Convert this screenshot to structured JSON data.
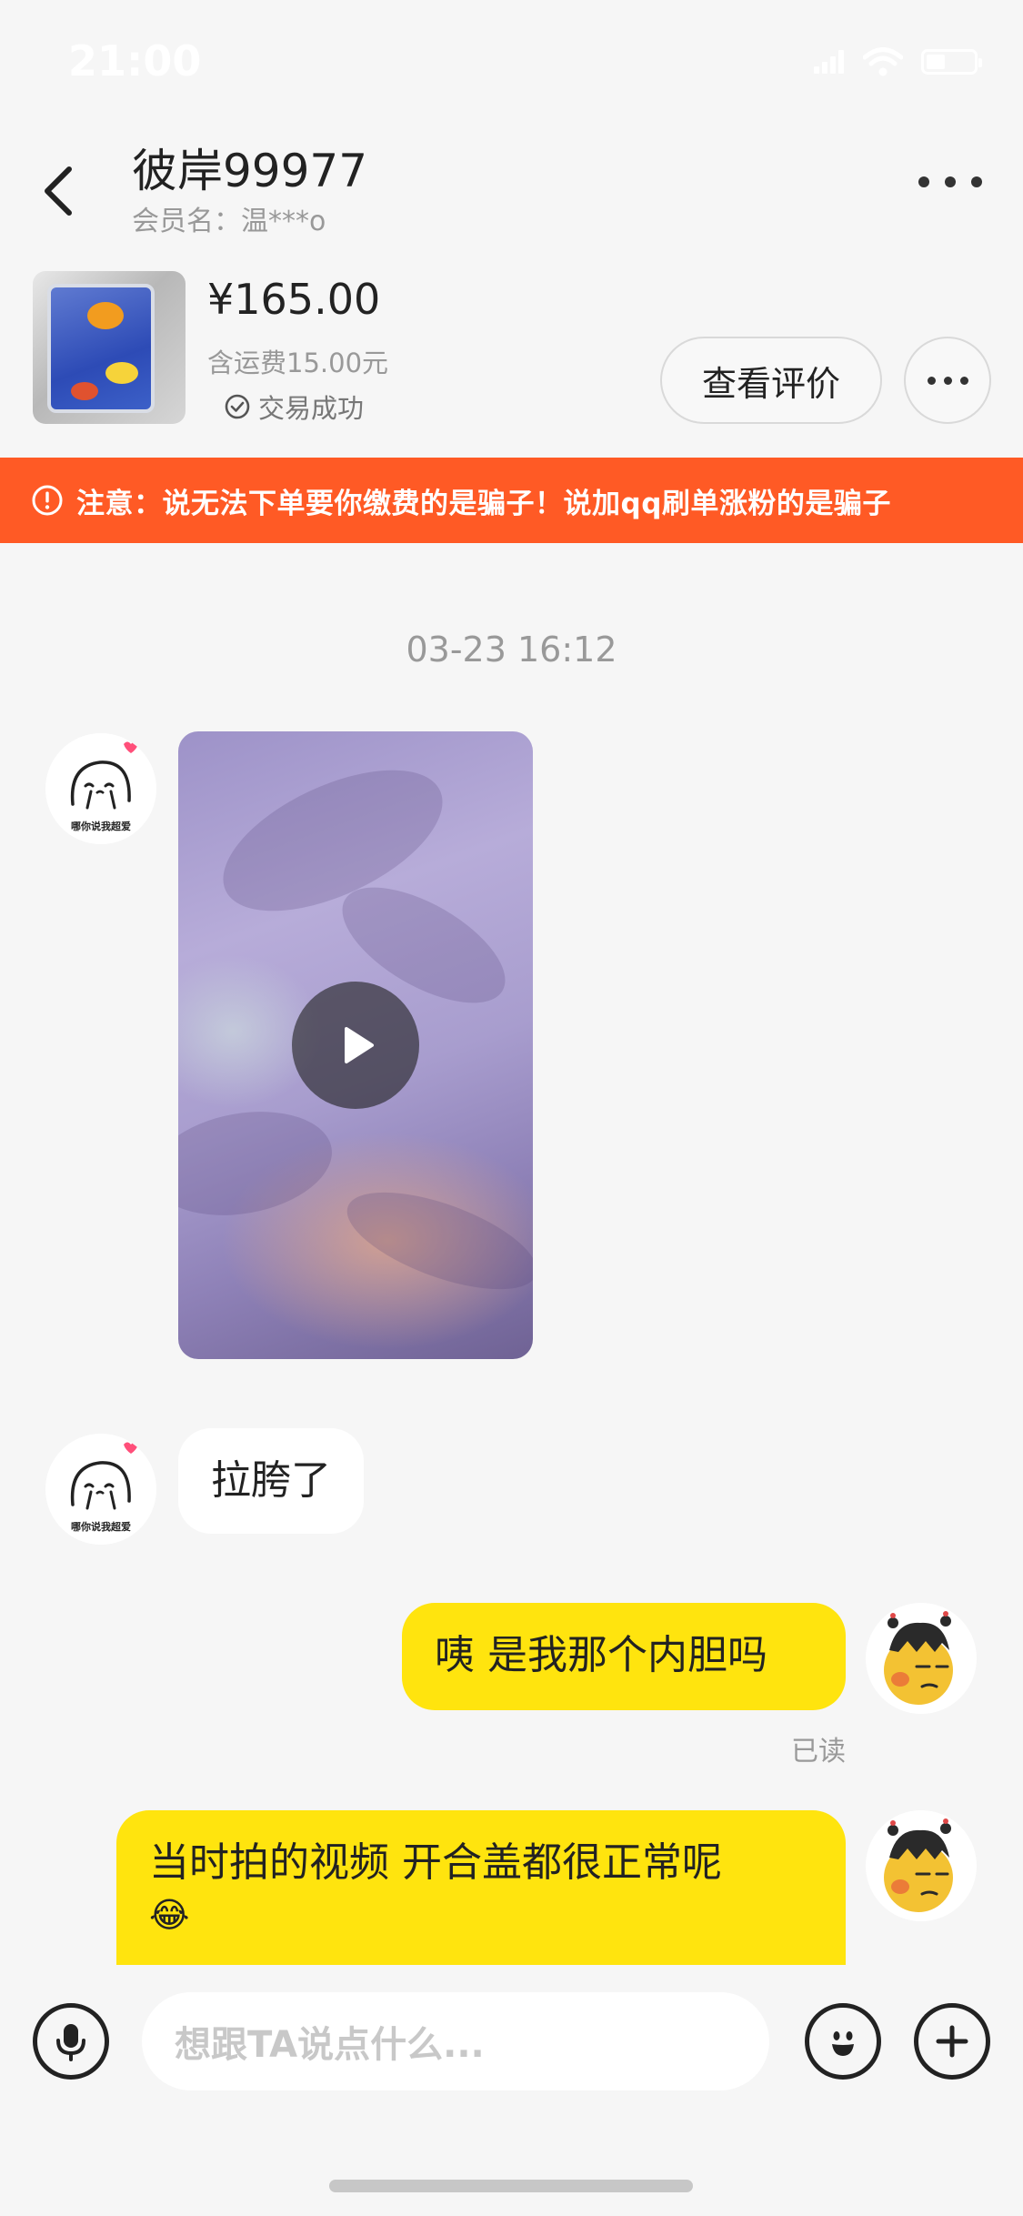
{
  "status_bar": {
    "time": "21:00"
  },
  "header": {
    "nickname": "彼岸99977",
    "member_label": "会员名：温***o"
  },
  "product": {
    "price": "¥165.00",
    "shipping": "含运费15.00元",
    "status": "交易成功",
    "review_button": "查看评价"
  },
  "warning": {
    "text": "注意：说无法下单要你缴费的是骗子！说加qq刷单涨粉的是骗子"
  },
  "chat": {
    "timestamp": "03-23 16:12",
    "messages": [
      {
        "side": "left",
        "type": "video"
      },
      {
        "side": "left",
        "type": "text",
        "text": "拉胯了"
      },
      {
        "side": "right",
        "type": "text",
        "text": "咦 是我那个内胆吗",
        "read": "已读"
      },
      {
        "side": "right",
        "type": "text",
        "text": "当时拍的视频 开合盖都很正常呢",
        "emoji": "😂"
      }
    ],
    "avatar_caption": "哪你说我超爱"
  },
  "input": {
    "placeholder": "想跟TA说点什么..."
  },
  "colors": {
    "warning_bg": "#ff5a25",
    "my_bubble": "#ffe40e",
    "their_bubble": "#ffffff",
    "page_bg": "#f6f6f6"
  },
  "icons": [
    "back-icon",
    "more-icon",
    "check-icon",
    "warning-icon",
    "play-icon",
    "mic-icon",
    "emoji-icon",
    "plus-icon"
  ]
}
